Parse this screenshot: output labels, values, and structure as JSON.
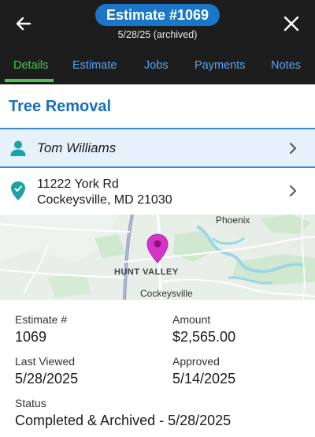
{
  "header": {
    "title": "Estimate #1069",
    "subtitle": "5/28/25 (archived)",
    "back_icon": "arrow-left-icon",
    "close_icon": "close-icon"
  },
  "tabs": [
    {
      "label": "Details",
      "active": true
    },
    {
      "label": "Estimate",
      "active": false
    },
    {
      "label": "Jobs",
      "active": false
    },
    {
      "label": "Payments",
      "active": false
    },
    {
      "label": "Notes",
      "active": false
    }
  ],
  "page": {
    "title": "Tree Removal"
  },
  "customer": {
    "name": "Tom Williams",
    "icon": "person-icon"
  },
  "address": {
    "line1": "11222 York Rd",
    "line2": "Cockeysville, MD 21030",
    "icon": "location-pin-icon"
  },
  "map": {
    "labels": {
      "phoenix": "Phoenix",
      "hunt_valley": "HUNT VALLEY",
      "cockeysville": "Cockeysville"
    },
    "marker_color": "#d633c8"
  },
  "details": {
    "estimate_label": "Estimate #",
    "estimate_value": "1069",
    "amount_label": "Amount",
    "amount_value": "$2,565.00",
    "last_viewed_label": "Last Viewed",
    "last_viewed_value": "5/28/2025",
    "approved_label": "Approved",
    "approved_value": "5/14/2025",
    "status_label": "Status",
    "status_value": "Completed & Archived - 5/28/2025"
  },
  "colors": {
    "topbar": "#1d1d1d",
    "accent_blue": "#1976c9",
    "tab_active": "#4cc64f",
    "tab_inactive": "#5aa4ef",
    "title_blue": "#1a6fbd",
    "teal_icon": "#1aa3a3"
  }
}
